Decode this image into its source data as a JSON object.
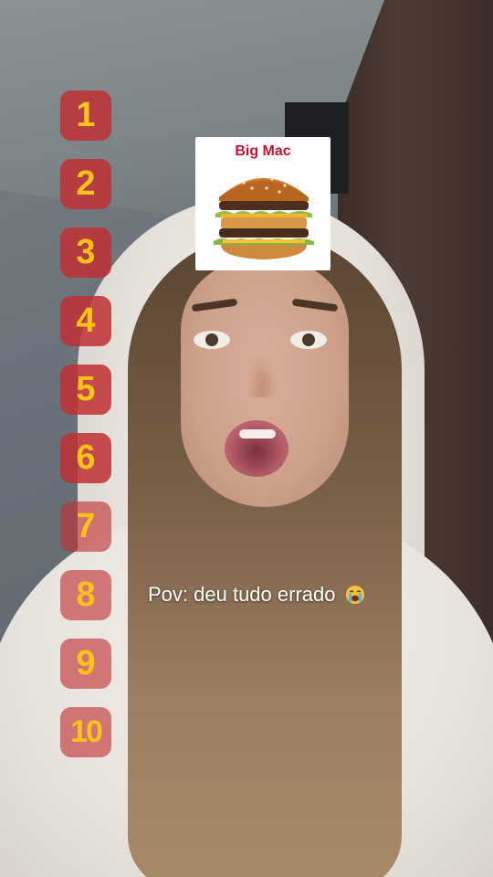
{
  "ranking": {
    "numbers": [
      "1",
      "2",
      "3",
      "4",
      "5",
      "6",
      "7",
      "8",
      "9",
      "10"
    ]
  },
  "card": {
    "title": "Big Mac"
  },
  "caption": {
    "text": "Pov: deu tudo errado"
  },
  "colors": {
    "badge_bg": "#c03034",
    "badge_text": "#fcc419",
    "card_title": "#c4122f"
  },
  "icons": {
    "caption_emoji": "loudly-crying-face"
  }
}
